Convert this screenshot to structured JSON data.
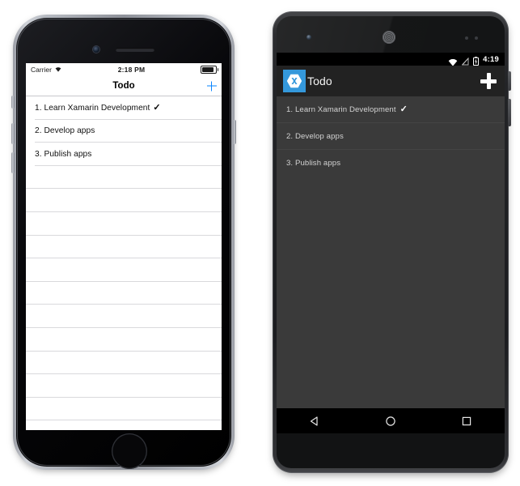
{
  "ios": {
    "device_name": "iPhone",
    "status_bar": {
      "carrier": "Carrier",
      "wifi_icon": "wifi-icon",
      "time": "2:18 PM",
      "battery_icon": "battery-full-icon"
    },
    "nav_bar": {
      "title": "Todo",
      "add_button": "+",
      "add_button_icon": "plus-icon",
      "accent_color": "#0a84ff"
    },
    "list": {
      "items": [
        {
          "text": "1. Learn Xamarin Development",
          "done": true,
          "check": "✓"
        },
        {
          "text": "2. Develop apps",
          "done": false,
          "check": ""
        },
        {
          "text": "3. Publish apps",
          "done": false,
          "check": ""
        }
      ],
      "empty_row_count": 11
    },
    "hardware": {
      "camera_icon": "front-camera-icon",
      "speaker_icon": "earpiece-speaker-icon",
      "home_button": "home-button",
      "silent_switch": "silent-switch",
      "volume_up": "volume-up-button",
      "volume_down": "volume-down-button",
      "power_button": "power-button"
    }
  },
  "android": {
    "device_name": "Android",
    "status_bar": {
      "wifi_icon": "wifi-icon",
      "signal_icon": "no-signal-icon",
      "battery_icon": "battery-charging-icon",
      "time": "4:19"
    },
    "action_bar": {
      "app_icon": "xamarin-logo-icon",
      "title": "Todo",
      "add_button": "+",
      "add_button_icon": "plus-icon",
      "logo_color": "#3498db",
      "bar_color": "#222222"
    },
    "list": {
      "items": [
        {
          "text": "1. Learn Xamarin Development",
          "done": true,
          "check": "✓"
        },
        {
          "text": "2. Develop apps",
          "done": false,
          "check": ""
        },
        {
          "text": "3. Publish apps",
          "done": false,
          "check": ""
        }
      ],
      "background_color": "#3a3a3a"
    },
    "nav_bar": {
      "back": "back-icon",
      "home": "home-icon",
      "recents": "recents-icon"
    },
    "hardware": {
      "camera_icon": "front-camera-icon",
      "speaker_icon": "earpiece-speaker-icon",
      "sensor_icon": "proximity-sensor-icon",
      "power_button": "power-button",
      "volume_button": "volume-button"
    }
  }
}
